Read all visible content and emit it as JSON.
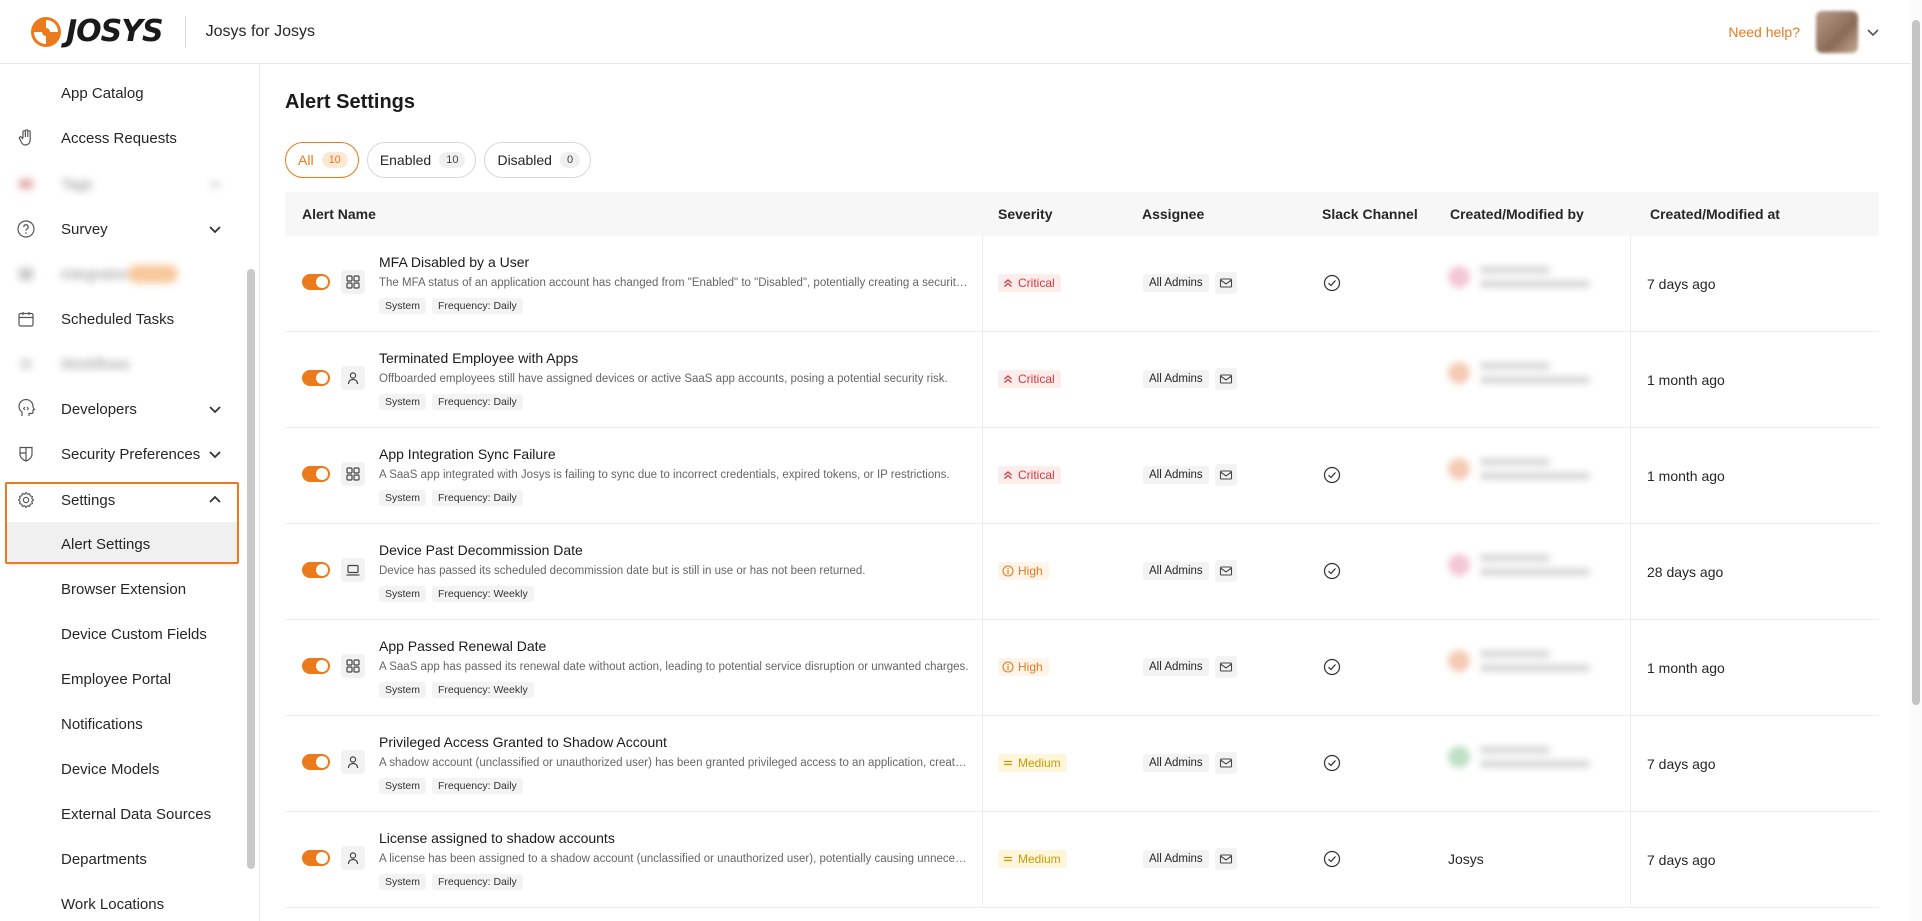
{
  "header": {
    "logo_text": "JOSYS",
    "workspace": "Josys for Josys",
    "help_label": "Need help?",
    "brand_color": "#ea7a1c"
  },
  "sidebar": {
    "items": [
      {
        "label": "App Catalog",
        "icon": "none"
      },
      {
        "label": "Access Requests",
        "icon": "hand-icon"
      },
      {
        "label": "Tags",
        "icon": "tag-icon",
        "blurred": true
      },
      {
        "label": "Survey",
        "icon": "question-circle-icon",
        "chevron": "down"
      },
      {
        "label": "Integrations",
        "icon": "plug-icon",
        "blurred": true
      },
      {
        "label": "Scheduled Tasks",
        "icon": "calendar-icon"
      },
      {
        "label": "Workflows",
        "icon": "flow-icon",
        "blurred": true
      },
      {
        "label": "Developers",
        "icon": "head-icon",
        "chevron": "down"
      },
      {
        "label": "Security Preferences",
        "icon": "shield-icon",
        "chevron": "down"
      },
      {
        "label": "Settings",
        "icon": "gear-icon",
        "chevron": "up"
      },
      {
        "label": "Alert Settings",
        "icon": "none",
        "active": true
      },
      {
        "label": "Browser Extension",
        "icon": "none"
      },
      {
        "label": "Device Custom Fields",
        "icon": "none"
      },
      {
        "label": "Employee Portal",
        "icon": "none"
      },
      {
        "label": "Notifications",
        "icon": "none"
      },
      {
        "label": "Device Models",
        "icon": "none"
      },
      {
        "label": "External Data Sources",
        "icon": "none"
      },
      {
        "label": "Departments",
        "icon": "none"
      },
      {
        "label": "Work Locations",
        "icon": "none"
      }
    ]
  },
  "main": {
    "title": "Alert Settings",
    "filters": [
      {
        "label": "All",
        "count": "10",
        "active": true
      },
      {
        "label": "Enabled",
        "count": "10"
      },
      {
        "label": "Disabled",
        "count": "0"
      }
    ],
    "columns": [
      "Alert Name",
      "Severity",
      "Assignee",
      "Slack Channel",
      "Created/Modified by",
      "Created/Modified at"
    ],
    "rows": [
      {
        "name": "MFA Disabled by a User",
        "desc": "The MFA status of an application account has changed from \"Enabled\" to \"Disabled\", potentially creating a security risk.",
        "type_icon": "grid-icon",
        "tags": [
          "System",
          "Frequency: Daily"
        ],
        "severity": "Critical",
        "assignee": "All Admins",
        "slack": true,
        "creator": "",
        "creator_blur": "#f3c6d6",
        "modified": "7 days ago"
      },
      {
        "name": "Terminated Employee with Apps",
        "desc": "Offboarded employees still have assigned devices or active SaaS app accounts, posing a potential security risk.",
        "type_icon": "user-icon",
        "tags": [
          "System",
          "Frequency: Daily"
        ],
        "severity": "Critical",
        "assignee": "All Admins",
        "slack": false,
        "creator": "",
        "creator_blur": "#f5c9b5",
        "modified": "1 month ago"
      },
      {
        "name": "App Integration Sync Failure",
        "desc": "A SaaS app integrated with Josys is failing to sync due to incorrect credentials, expired tokens, or IP restrictions.",
        "type_icon": "grid-icon",
        "tags": [
          "System",
          "Frequency: Daily"
        ],
        "severity": "Critical",
        "assignee": "All Admins",
        "slack": true,
        "creator": "",
        "creator_blur": "#f5c9b5",
        "modified": "1 month ago"
      },
      {
        "name": "Device Past Decommission Date",
        "desc": "Device has passed its scheduled decommission date but is still in use or has not been returned.",
        "type_icon": "laptop-icon",
        "tags": [
          "System",
          "Frequency: Weekly"
        ],
        "severity": "High",
        "assignee": "All Admins",
        "slack": true,
        "creator": "",
        "creator_blur": "#f3c6d6",
        "modified": "28 days ago"
      },
      {
        "name": "App Passed Renewal Date",
        "desc": "A SaaS app has passed its renewal date without action, leading to potential service disruption or unwanted charges.",
        "type_icon": "grid-icon",
        "tags": [
          "System",
          "Frequency: Weekly"
        ],
        "severity": "High",
        "assignee": "All Admins",
        "slack": true,
        "creator": "",
        "creator_blur": "#f5c9b5",
        "modified": "1 month ago"
      },
      {
        "name": "Privileged Access Granted to Shadow Account",
        "desc": "A shadow account (unclassified or unauthorized user) has been granted privileged access to an application, creating a risk.",
        "type_icon": "user-icon",
        "tags": [
          "System",
          "Frequency: Daily"
        ],
        "severity": "Medium",
        "assignee": "All Admins",
        "slack": true,
        "creator": "",
        "creator_blur": "#bfe0c4",
        "modified": "7 days ago"
      },
      {
        "name": "License assigned to shadow accounts",
        "desc": "A license has been assigned to a shadow account (unclassified or unauthorized user), potentially causing unnecessary costs.",
        "type_icon": "user-icon",
        "tags": [
          "System",
          "Frequency: Daily"
        ],
        "severity": "Medium",
        "assignee": "All Admins",
        "slack": true,
        "creator": "Josys",
        "creator_blur": "",
        "modified": "7 days ago"
      }
    ]
  }
}
